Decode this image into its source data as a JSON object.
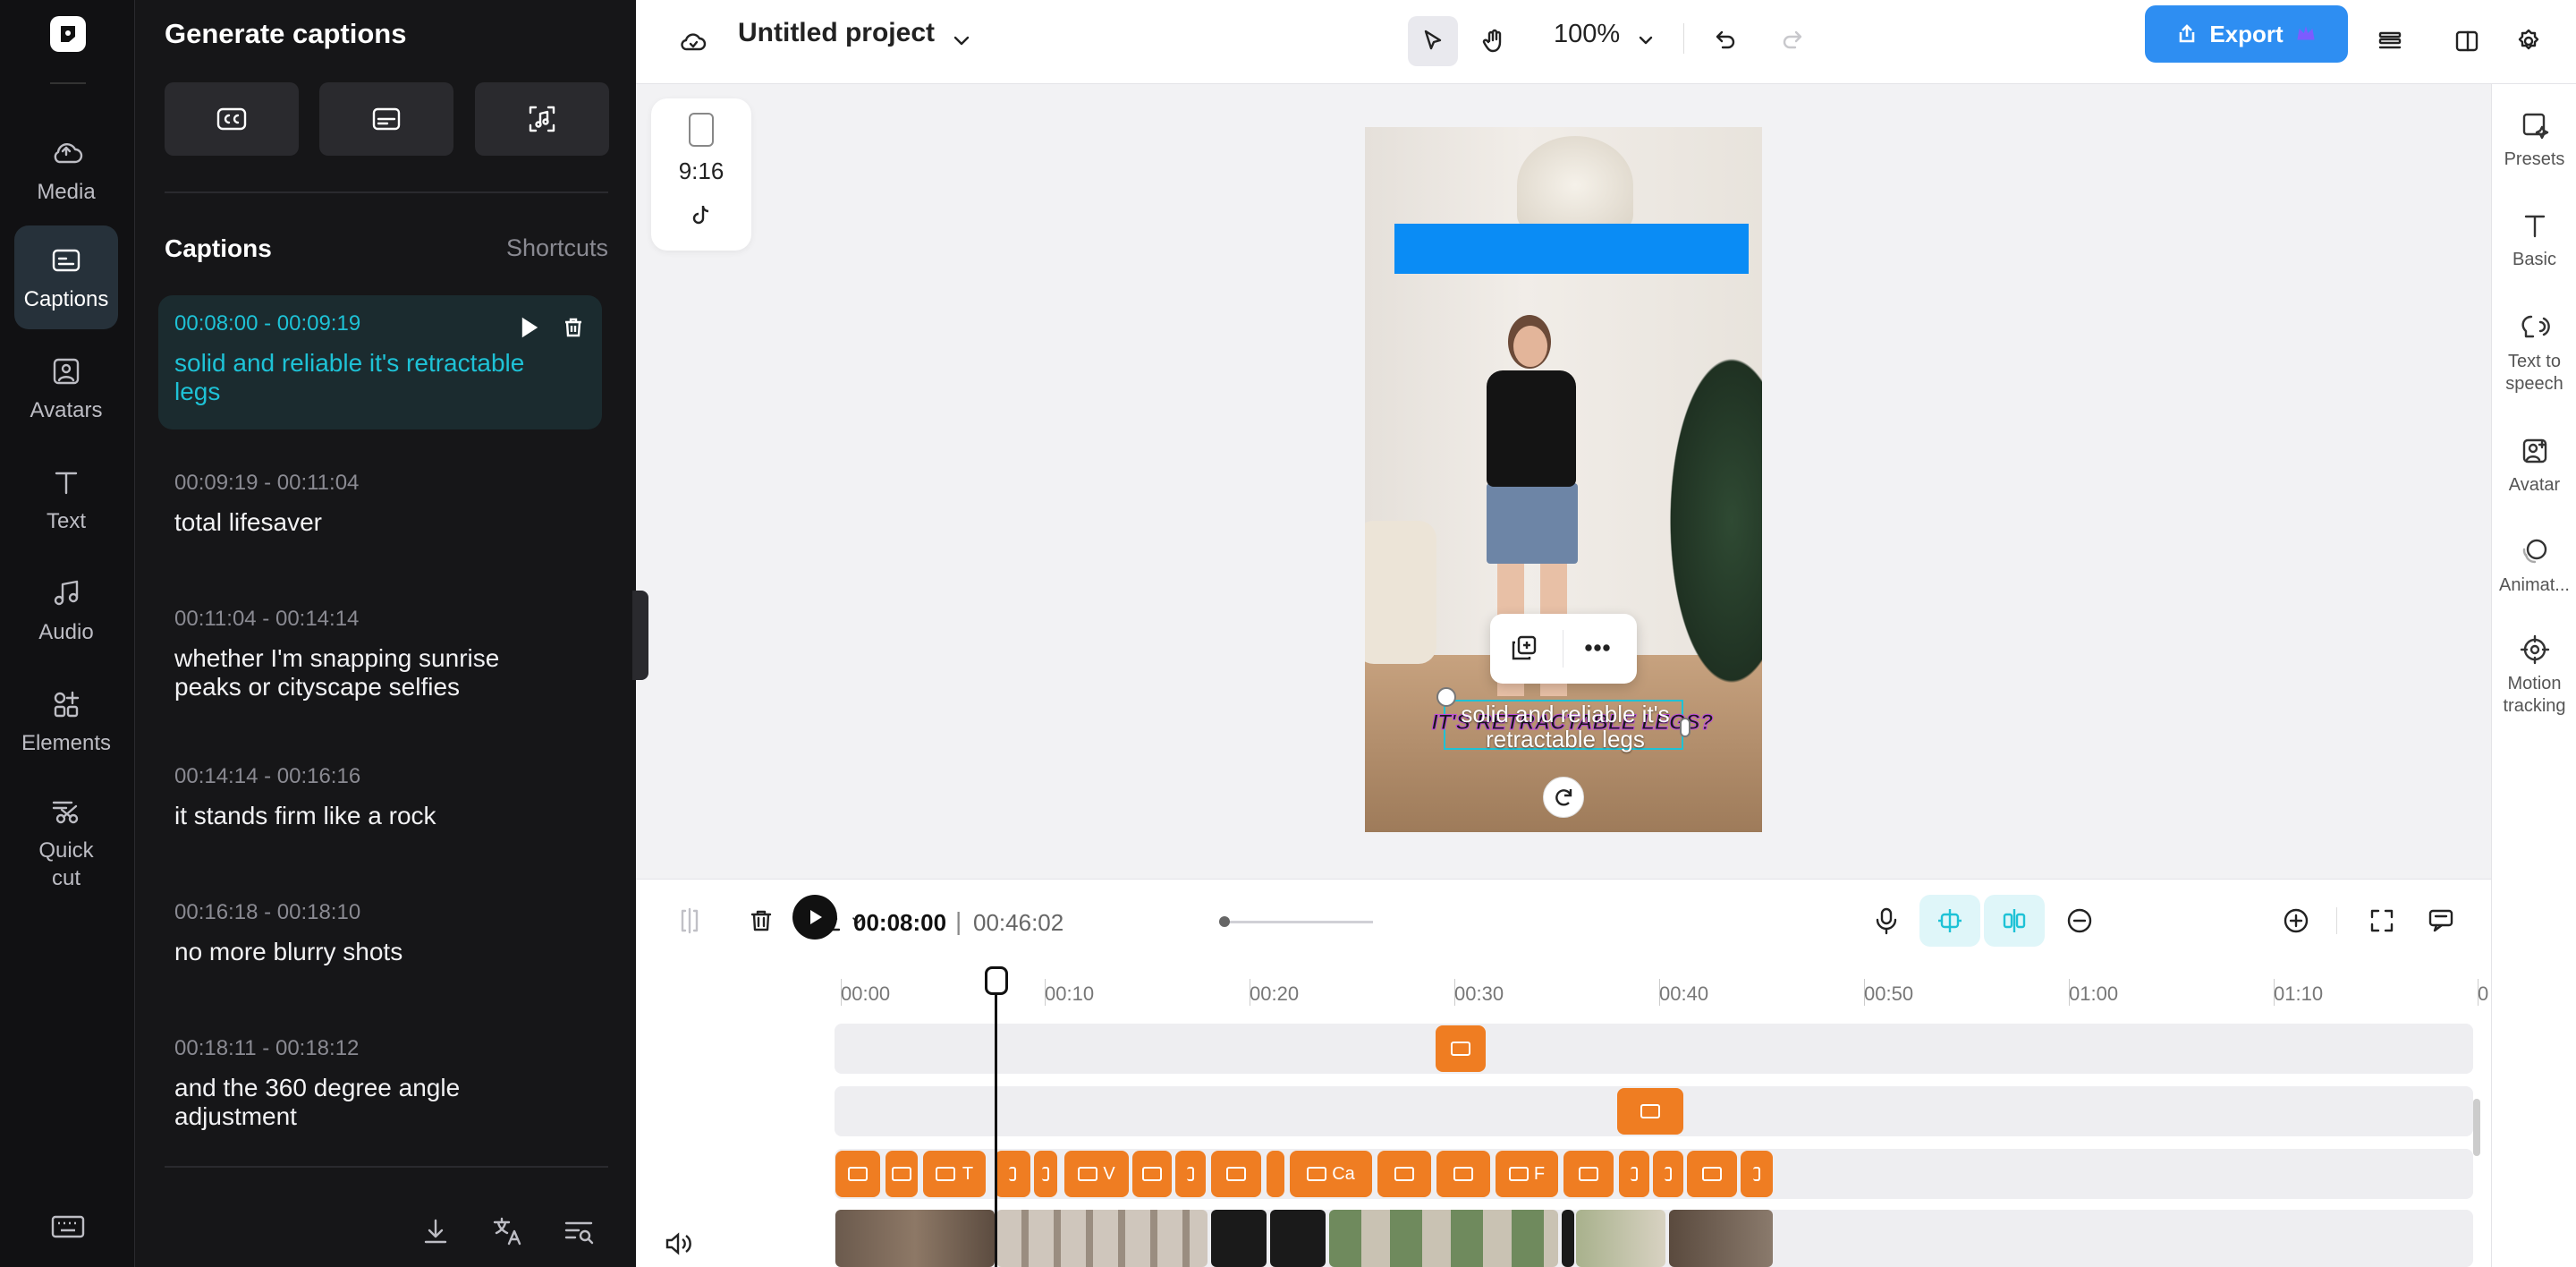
{
  "rail": {
    "items": [
      {
        "label": "Media",
        "icon": "cloud-upload-icon"
      },
      {
        "label": "Captions",
        "icon": "captions-icon",
        "active": true
      },
      {
        "label": "Avatars",
        "icon": "avatar-icon"
      },
      {
        "label": "Text",
        "icon": "text-icon"
      },
      {
        "label": "Audio",
        "icon": "music-note-icon"
      },
      {
        "label": "Elements",
        "icon": "elements-icon"
      },
      {
        "label": "Quick cut",
        "icon": "scissors-icon"
      }
    ],
    "keyboard_icon": "keyboard-icon"
  },
  "panel": {
    "title": "Generate captions",
    "section_title": "Captions",
    "shortcuts_label": "Shortcuts",
    "captions": [
      {
        "time": "00:08:00 - 00:09:19",
        "text": "solid and reliable it's retractable legs",
        "active": true
      },
      {
        "time": "00:09:19 - 00:11:04",
        "text": "total lifesaver"
      },
      {
        "time": "00:11:04 - 00:14:14",
        "text": "whether I'm snapping sunrise peaks or cityscape selfies"
      },
      {
        "time": "00:14:14 - 00:16:16",
        "text": "it stands firm like a rock"
      },
      {
        "time": "00:16:18 - 00:18:10",
        "text": "no more blurry shots"
      },
      {
        "time": "00:18:11 - 00:18:12",
        "text": "and the 360 degree angle adjustment"
      }
    ]
  },
  "topbar": {
    "project_name": "Untitled project",
    "zoom": "100%",
    "export_label": "Export"
  },
  "canvas": {
    "aspect_ratio": "9:16",
    "caption_text": "solid and reliable it's retractable legs",
    "caption_ghost": "IT'S RETRACTABLE LEGS?"
  },
  "right_panel": {
    "items": [
      {
        "label": "Presets",
        "icon": "presets-icon"
      },
      {
        "label": "Basic",
        "icon": "text-basic-icon"
      },
      {
        "label": "Text to speech",
        "icon": "speech-icon"
      },
      {
        "label": "Avatar",
        "icon": "avatar-icon"
      },
      {
        "label": "Animat...",
        "icon": "animation-icon"
      },
      {
        "label": "Motion tracking",
        "icon": "target-icon"
      }
    ]
  },
  "timeline": {
    "current_time": "00:08:00",
    "total_time": "00:46:02",
    "separator": "|",
    "ticks": [
      "00:00",
      "00:10",
      "00:20",
      "00:30",
      "00:40",
      "00:50",
      "01:00",
      "01:10",
      "0"
    ],
    "clip_labels": [
      "Ca",
      "V",
      "F",
      "T"
    ]
  },
  "colors": {
    "accent": "#1ec2d6",
    "export": "#2e8ef2",
    "clip": "#ef7d22",
    "rail_bg": "#111113",
    "panel_bg": "#161618"
  }
}
